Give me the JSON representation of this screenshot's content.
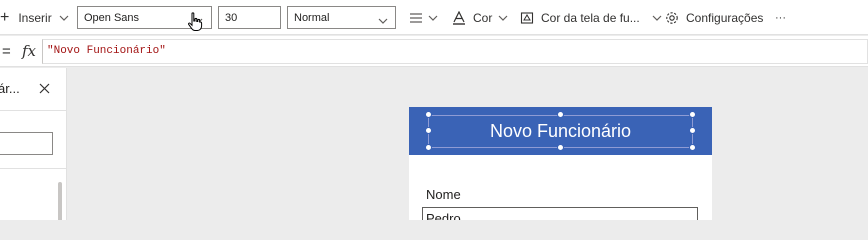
{
  "toolbar": {
    "insert_label": "Inserir",
    "font_family_value": "Open Sans",
    "font_size_value": "30",
    "font_weight_value": "Normal",
    "color_label": "Cor",
    "screen_color_label": "Cor da tela de fu...",
    "settings_label": "Configurações",
    "more_label": "···"
  },
  "formula_bar": {
    "equals": "=",
    "fx": "fx",
    "formula": "\"Novo Funcionário\""
  },
  "panel": {
    "title": "ár...",
    "close_glyph": "✕"
  },
  "canvas": {
    "header_title": "Novo Funcionário",
    "field_label": "Nome",
    "field_value": "Pedro"
  },
  "colors": {
    "header_bg": "#3a63b6",
    "canvas_bg": "#ececec",
    "formula_text": "#a31515"
  }
}
